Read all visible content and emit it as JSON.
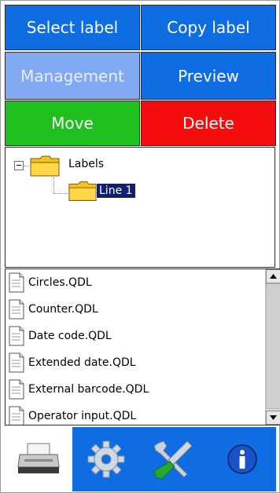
{
  "buttons": {
    "select_label": "Select label",
    "copy_label": "Copy label",
    "management": "Management",
    "preview": "Preview",
    "move": "Move",
    "delete": "Delete"
  },
  "tree": {
    "root": {
      "label": "Labels",
      "icon": "folder-icon",
      "expanded": true
    },
    "child": {
      "label": "Line 1",
      "icon": "folder-icon",
      "selected": true
    }
  },
  "file_list": {
    "items": [
      {
        "label": "Circles.QDL",
        "icon": "document-icon"
      },
      {
        "label": "Counter.QDL",
        "icon": "document-icon"
      },
      {
        "label": "Date code.QDL",
        "icon": "document-icon"
      },
      {
        "label": "Extended date.QDL",
        "icon": "document-icon"
      },
      {
        "label": "External barcode.QDL",
        "icon": "document-icon"
      },
      {
        "label": "Operator input.QDL",
        "icon": "document-icon"
      }
    ]
  },
  "toolbar": {
    "items": [
      {
        "icon": "printer-icon",
        "active": true
      },
      {
        "icon": "gear-icon",
        "active": false
      },
      {
        "icon": "tools-icon",
        "active": false
      },
      {
        "icon": "info-icon",
        "active": false
      }
    ]
  },
  "colors": {
    "blue": "#0f6de3",
    "light_blue": "#82aaf2",
    "green": "#20bf20",
    "red": "#f50c0c",
    "selection": "#10206e"
  }
}
